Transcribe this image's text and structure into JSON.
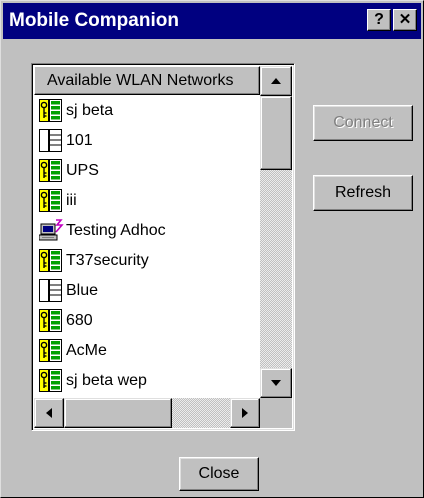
{
  "window": {
    "title": "Mobile Companion",
    "help_label": "?",
    "close_label": "✕"
  },
  "networks_list": {
    "column_header": "Available WLAN Networks",
    "items": [
      {
        "label": "sj beta",
        "icon": "secure-network-icon"
      },
      {
        "label": "101",
        "icon": "open-network-icon"
      },
      {
        "label": "UPS",
        "icon": "secure-network-icon"
      },
      {
        "label": "iii",
        "icon": "secure-network-icon"
      },
      {
        "label": "Testing Adhoc",
        "icon": "adhoc-computer-icon"
      },
      {
        "label": "T37security",
        "icon": "secure-network-icon"
      },
      {
        "label": "Blue",
        "icon": "open-network-icon"
      },
      {
        "label": "680",
        "icon": "secure-network-icon"
      },
      {
        "label": "AcMe",
        "icon": "secure-network-icon"
      },
      {
        "label": "sj beta wep",
        "icon": "secure-network-icon"
      }
    ]
  },
  "buttons": {
    "connect": "Connect",
    "refresh": "Refresh",
    "close": "Close"
  },
  "colors": {
    "face": "#c0c0c0",
    "titlebar": "#000080",
    "signal_green": "#00a000",
    "key_yellow": "#ffff00"
  }
}
